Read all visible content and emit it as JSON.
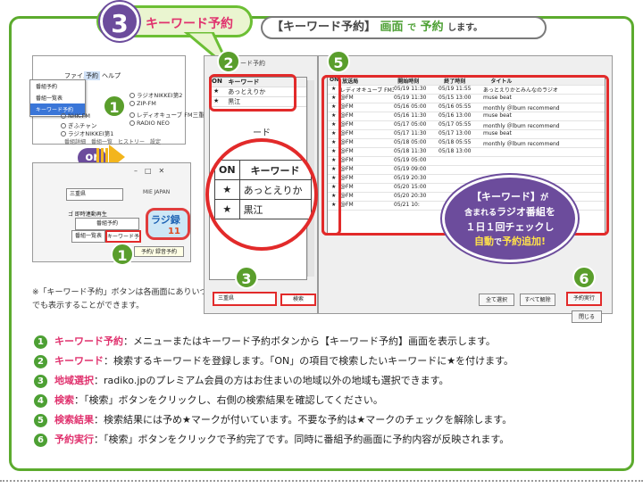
{
  "header": {
    "step_number": "3",
    "step_title": "キーワード予約",
    "banner_pre": "【キーワード予約】",
    "banner_screen": "画面",
    "banner_de": "で",
    "banner_yoyaku": "予約",
    "banner_post": "します。"
  },
  "main_window": {
    "menus": [
      "ファイル",
      "予約",
      "ヘルプ"
    ],
    "dropdown_items": [
      "番組予約",
      "番組一覧表",
      "キーワード予約"
    ],
    "radio_labels": [
      "ラジオNIKKEI第2",
      "ZIP-FM",
      "レディオキューブ FM三重",
      "NHK-FM",
      "ぎふチャン",
      "RADIO NEO",
      "ラジオNIKKEI第1"
    ],
    "tabs_partial": "番組詳細　番組一覧　ヒストリー　設定"
  },
  "or_label": "or",
  "tool_panel": {
    "window_controls": "–　□　✕",
    "region_select": "三重県",
    "station_label": "MIE JAPAN",
    "checkbox_label": "ゴ 即時連動再生",
    "btn_program_reserve": "番組予約",
    "btn_program_list": "番組一覧表",
    "btn_keyword_reserve": "キーワード予約",
    "tooltip": "予約/ 録音予約",
    "radiko_logo": "ラジ録",
    "radiko_ver": "11"
  },
  "note": "※「キーワード予約」ボタンは各画面にありいつでも表示することができます。",
  "keyword_window": {
    "title": "キーワード予約",
    "col_on": "ON",
    "col_keyword": "キーワード",
    "rows": [
      {
        "on": "★",
        "keyword": "あっとえりか"
      },
      {
        "on": "★",
        "keyword": "黒江"
      }
    ],
    "region": "三重県",
    "search_button": "検索",
    "zoom_partial": "ード"
  },
  "results": {
    "headers": [
      "ON",
      "放送局",
      "開始時刻",
      "終了時刻",
      "タイトル"
    ],
    "rows": [
      [
        "★",
        "レディオキューブ FM三重",
        "05/19 11:30",
        "05/19 11:55",
        "あっとえりかとみんなのラジオ"
      ],
      [
        "★",
        "@FM",
        "05/19 11:30",
        "05/15 13:00",
        "muse beat"
      ],
      [
        "★",
        "@FM",
        "05/16 05:00",
        "05/16 05:55",
        "monthly ＠lbum recommend"
      ],
      [
        "★",
        "@FM",
        "05/16 11:30",
        "05/16 13:00",
        "muse beat"
      ],
      [
        "★",
        "@FM",
        "05/17 05:00",
        "05/17 05:55",
        "monthly ＠lbum recommend"
      ],
      [
        "★",
        "@FM",
        "05/17 11:30",
        "05/17 13:00",
        "muse beat"
      ],
      [
        "★",
        "@FM",
        "05/18 05:00",
        "05/18 05:55",
        "monthly ＠lbum recommend"
      ],
      [
        "★",
        "@FM",
        "05/18 11:30",
        "05/18 13:00",
        ""
      ],
      [
        "★",
        "@FM",
        "05/19 05:00",
        "",
        ""
      ],
      [
        "★",
        "@FM",
        "05/19 09:00",
        "",
        ""
      ],
      [
        "★",
        "@FM",
        "05/19 20:30",
        "",
        ""
      ],
      [
        "★",
        "@FM",
        "05/20 15:00",
        "",
        ""
      ],
      [
        "★",
        "@FM",
        "05/20 20:30",
        "",
        ""
      ],
      [
        "★",
        "@FM",
        "05/21 10:",
        "",
        "ラジオ"
      ]
    ],
    "btn_select_all": "全て選択",
    "btn_deselect_all": "すべて解除",
    "btn_execute": "予約実行",
    "btn_close": "閉じる"
  },
  "callout": {
    "line1_a": "【キーワード】",
    "line1_b": "が",
    "line2_a": "含まれる",
    "line2_b": "ラジオ番組を",
    "line3": "１日１回チェックし",
    "line4_a": "自動",
    "line4_b": "で",
    "line4_c": "予約追加",
    "line4_d": "!"
  },
  "step_badges": [
    "1",
    "1",
    "2",
    "3",
    "4",
    "5",
    "6"
  ],
  "legend": [
    {
      "num": "1",
      "key": "キーワード予約",
      "text": "：メニューまたはキーワード予約ボタンから【キーワード予約】画面を表示します。"
    },
    {
      "num": "2",
      "key": "キーワード",
      "text": "：検索するキーワードを登録します。「ON」の項目で検索したいキーワードに★を付けます。"
    },
    {
      "num": "3",
      "key": "地域選択",
      "text": "：radiko.jpのプレミアム会員の方はお住まいの地域以外の地域も選択できます。"
    },
    {
      "num": "4",
      "key": "検索",
      "text": "：「検索」ボタンをクリックし、右側の検索結果を確認してください。"
    },
    {
      "num": "5",
      "key": "検索結果",
      "text": "：検索結果には予め★マークが付いています。不要な予約は★マークのチェックを解除します。"
    },
    {
      "num": "6",
      "key": "予約実行",
      "text": "：「検索」ボタンをクリックで予約完了です。同時に番組予約画面に予約内容が反映されます。"
    }
  ],
  "colors": {
    "green": "#5cab2e",
    "purple": "#6c4c9c",
    "pink": "#e0326e",
    "red": "#e22a2a"
  }
}
